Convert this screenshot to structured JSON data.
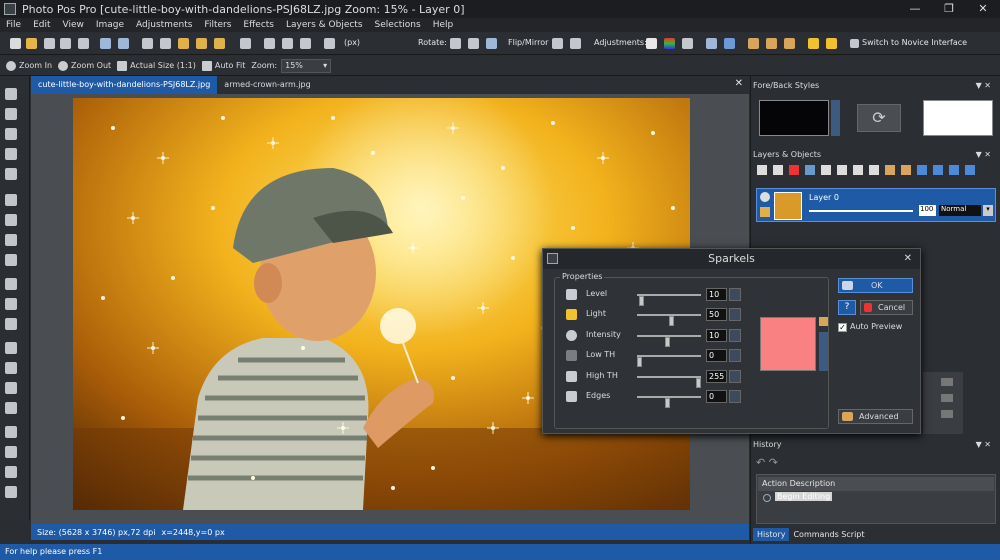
{
  "app": {
    "title": "Photo Pos Pro [cute-little-boy-with-dandelions-PSJ68LZ.jpg Zoom: 15% - Layer 0]",
    "window_buttons": [
      "—",
      "❐",
      "✕"
    ]
  },
  "menu": [
    "File",
    "Edit",
    "View",
    "Image",
    "Adjustments",
    "Filters",
    "Effects",
    "Layers & Objects",
    "Selections",
    "Help"
  ],
  "toolbar": {
    "unit": "(px)",
    "rotate_label": "Rotate:",
    "flip_label": "Flip/Mirror",
    "adjust_label": "Adjustments:",
    "novice_label": "Switch to Novice Interface"
  },
  "toolbar2": {
    "zoom_in": "Zoom In",
    "zoom_out": "Zoom Out",
    "actual_size": "Actual Size (1:1)",
    "auto_fit": "Auto Fit",
    "zoom_label": "Zoom:",
    "zoom_value": "15%"
  },
  "tabs": [
    "cute-little-boy-with-dandelions-PSJ68LZ.jpg",
    "armed-crown-arm.jpg"
  ],
  "status": {
    "size": "Size: (5628 x 3746) px,72 dpi",
    "coords": "x=2448,y=0 px"
  },
  "bottom_status": "For help please press F1",
  "panels": {
    "foreback": {
      "title": "Fore/Back Styles",
      "fore_color": "#050508",
      "back_color": "#ffffff"
    },
    "layers": {
      "title": "Layers & Objects",
      "layer_name": "Layer 0",
      "opacity": "100",
      "blend": "Normal"
    },
    "history": {
      "title": "History",
      "header": "Action Description",
      "item": "Begin Editing",
      "tabs": [
        "History",
        "Commands Script"
      ]
    }
  },
  "dialog": {
    "title": "Sparkels",
    "properties_label": "Properties",
    "rows": [
      {
        "label": "Level",
        "value": "10",
        "level": 0.04
      },
      {
        "label": "Light",
        "value": "50",
        "level": 0.55
      },
      {
        "label": "Intensity",
        "value": "10",
        "level": 0.48
      },
      {
        "label": "Low TH",
        "value": "0",
        "level": 0.0
      },
      {
        "label": "High TH",
        "value": "255",
        "level": 1.0
      },
      {
        "label": "Edges",
        "value": "0",
        "level": 0.48
      }
    ],
    "ok": "OK",
    "cancel": "Cancel",
    "auto_preview": "Auto Preview",
    "advanced": "Advanced",
    "help": "?",
    "preview_color": "#f98181"
  }
}
